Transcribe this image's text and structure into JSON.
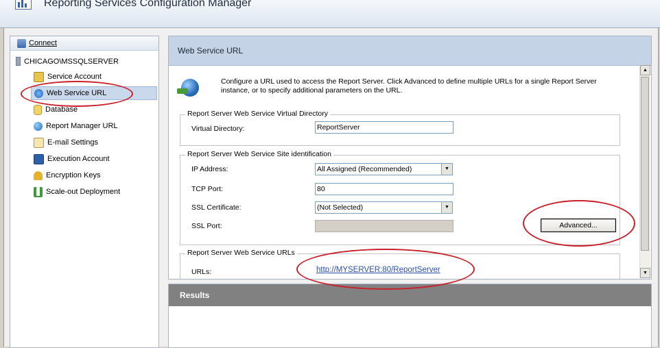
{
  "window": {
    "title": "Reporting Services Configuration Manager"
  },
  "nav": {
    "connect_label": "Connect",
    "server": "CHICAGO\\MSSQLSERVER",
    "items": [
      {
        "label": "Service Account",
        "icon": "service-account-icon"
      },
      {
        "label": "Web Service URL",
        "icon": "web-service-icon",
        "selected": true
      },
      {
        "label": "Database",
        "icon": "database-icon"
      },
      {
        "label": "Report Manager URL",
        "icon": "globe-icon"
      },
      {
        "label": "E-mail Settings",
        "icon": "email-icon"
      },
      {
        "label": "Execution Account",
        "icon": "execution-account-icon"
      },
      {
        "label": "Encryption Keys",
        "icon": "keys-icon"
      },
      {
        "label": "Scale-out Deployment",
        "icon": "scale-out-icon"
      }
    ]
  },
  "page": {
    "title": "Web Service URL",
    "intro": "Configure a URL used to access the Report Server.  Click Advanced to define multiple URLs for a single Report Server instance, or to specify additional parameters on the URL.",
    "vdir_group": {
      "legend": "Report Server Web Service Virtual Directory",
      "vdir_label": "Virtual Directory:",
      "vdir_value": "ReportServer"
    },
    "site_group": {
      "legend": "Report Server Web Service Site identification",
      "ip_label": "IP Address:",
      "ip_value": "All Assigned (Recommended)",
      "tcp_label": "TCP Port:",
      "tcp_value": "80",
      "ssl_cert_label": "SSL Certificate:",
      "ssl_cert_value": "(Not Selected)",
      "ssl_port_label": "SSL Port:",
      "ssl_port_value": "",
      "advanced_label": "Advanced..."
    },
    "urls_group": {
      "legend": "Report Server Web Service URLs",
      "urls_label": "URLs:",
      "url": "http://MYSERVER:80/ReportServer"
    }
  },
  "results": {
    "title": "Results"
  },
  "colors": {
    "highlight": "#c8202a",
    "selection": "#cad8ec",
    "header": "#c5d3e6",
    "link": "#2b4fb0"
  }
}
